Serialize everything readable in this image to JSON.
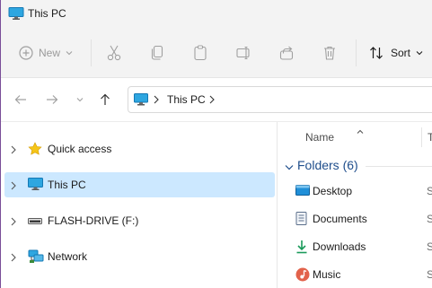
{
  "window": {
    "title": "This PC"
  },
  "toolbar": {
    "new_label": "New",
    "sort_label": "Sort"
  },
  "address": {
    "path": "This PC"
  },
  "nav_pane": {
    "items": [
      {
        "label": "Quick access",
        "icon": "star-icon"
      },
      {
        "label": "This PC",
        "icon": "computer-icon",
        "selected": true
      },
      {
        "label": "FLASH-DRIVE (F:)",
        "icon": "drive-icon"
      },
      {
        "label": "Network",
        "icon": "network-icon"
      }
    ]
  },
  "content": {
    "columns": {
      "name": "Name",
      "type": "Ty"
    },
    "group": {
      "label": "Folders (6)"
    },
    "rows": [
      {
        "name": "Desktop",
        "type": "S",
        "icon": "desktop-folder-icon"
      },
      {
        "name": "Documents",
        "type": "S",
        "icon": "documents-folder-icon"
      },
      {
        "name": "Downloads",
        "type": "S",
        "icon": "downloads-folder-icon"
      },
      {
        "name": "Music",
        "type": "S",
        "icon": "music-folder-icon"
      }
    ]
  },
  "colors": {
    "selection": "#cce8ff",
    "group_header": "#1f4e8c",
    "accent": "#0078d4"
  }
}
